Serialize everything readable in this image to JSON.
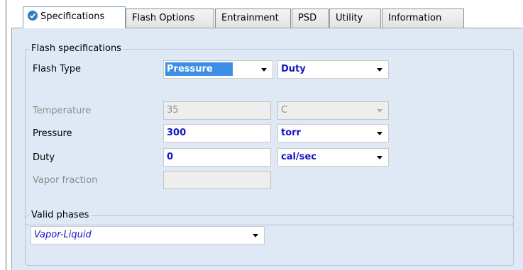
{
  "tabs": [
    {
      "label": "Specifications",
      "active": true,
      "icon": "check-circle-icon"
    },
    {
      "label": "Flash Options"
    },
    {
      "label": "Entrainment"
    },
    {
      "label": "PSD"
    },
    {
      "label": "Utility"
    },
    {
      "label": "Information"
    }
  ],
  "flash_specs": {
    "title": "Flash specifications",
    "flash_type_label": "Flash Type",
    "flash_type_1": "Pressure",
    "flash_type_2": "Duty",
    "temperature_label": "Temperature",
    "temperature_value": "35",
    "temperature_unit": "C",
    "pressure_label": "Pressure",
    "pressure_value": "300",
    "pressure_unit": "torr",
    "duty_label": "Duty",
    "duty_value": "0",
    "duty_unit": "cal/sec",
    "vapor_fraction_label": "Vapor fraction",
    "vapor_fraction_value": ""
  },
  "valid_phases": {
    "title": "Valid phases",
    "value": "Vapor-Liquid"
  },
  "colors": {
    "panel_bg": "#dfe9f5",
    "active_value_text": "#1414c8",
    "selection": "#3c8fe6",
    "check_icon": "#3a78c4"
  }
}
